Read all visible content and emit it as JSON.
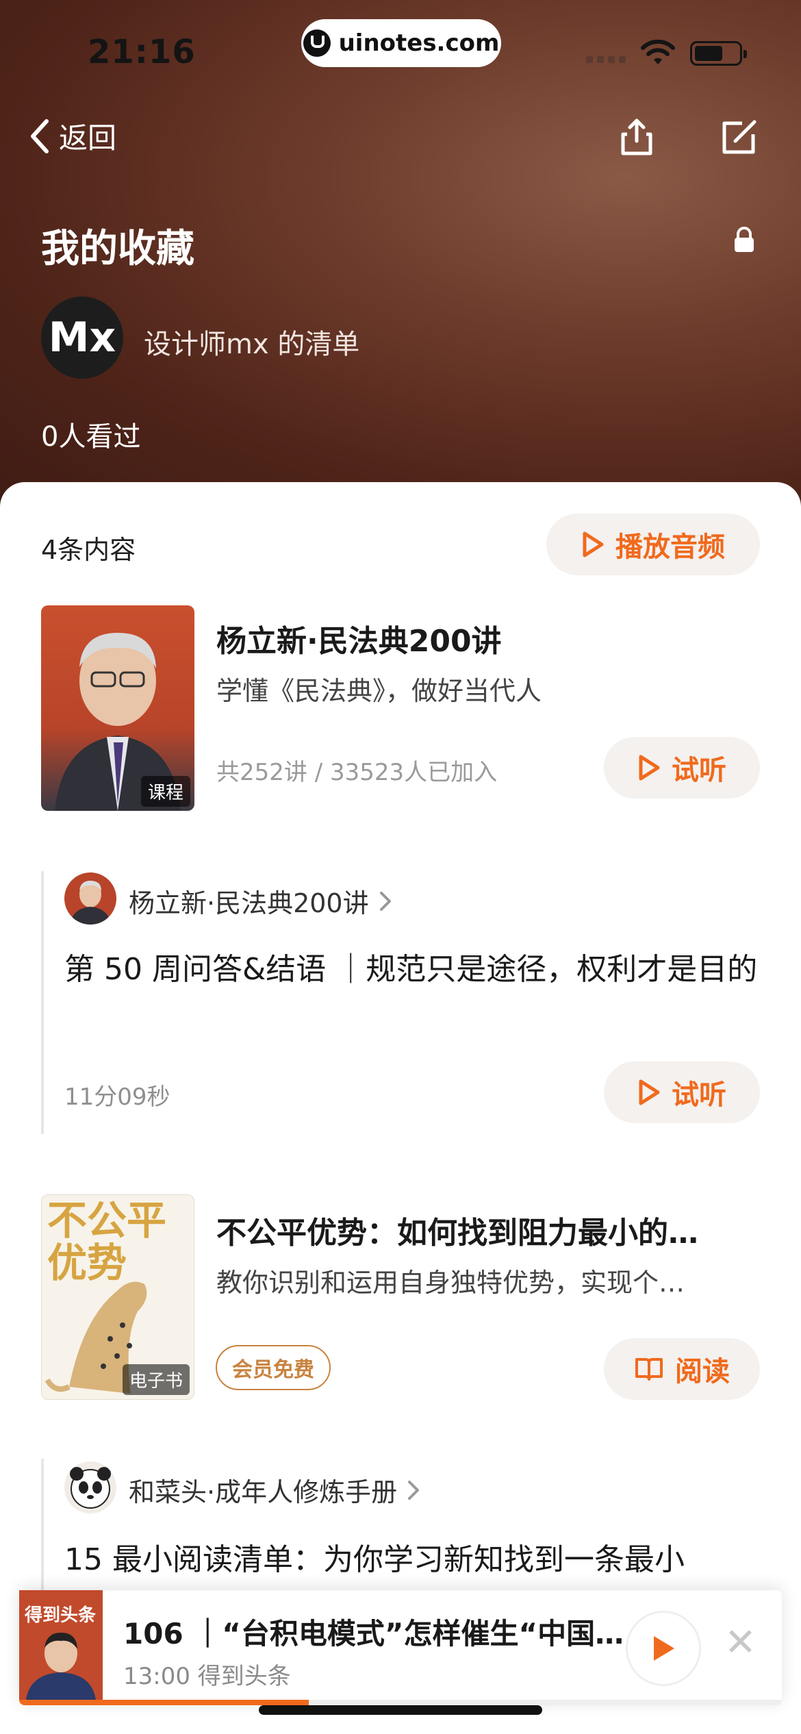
{
  "status_bar": {
    "time": "21:16",
    "url": "uinotes.com"
  },
  "nav": {
    "back_label": "返回"
  },
  "header": {
    "title": "我的收藏",
    "owner": "设计师mx 的清单",
    "views": "0人看过",
    "avatar_text": "Mx"
  },
  "list": {
    "count": "4条内容",
    "play_audio_label": "播放音频",
    "items": [
      {
        "cover_tag": "课程",
        "title": "杨立新·民法典200讲",
        "subtitle": "学懂《民法典》，做好当代人",
        "meta": "共252讲 / 33523人已加入",
        "action": "试听"
      },
      {
        "source": "杨立新·民法典200讲",
        "title": "第 50 周问答&结语 ｜规范只是途径，权利才是目的",
        "meta": "11分09秒",
        "action": "试听"
      },
      {
        "cover_tag": "电子书",
        "cover_text": "不公平优势",
        "title": "不公平优势：如何找到阻力最小的…",
        "subtitle": "教你识别和运用自身独特优势，实现个…",
        "badge": "会员免费",
        "action": "阅读"
      },
      {
        "source": "和菜头·成年人修炼手册",
        "title": "15 最小阅读清单：为你学习新知找到一条最小"
      }
    ]
  },
  "mini_player": {
    "cover_text": "得到头条",
    "title": "106 ｜“台积电模式”怎样催生“中国…",
    "subtitle": "13:00 得到头条",
    "progress": 0.38
  },
  "colors": {
    "accent": "#f06a1d",
    "hero": "#5a2a1e",
    "badge": "#c8833f"
  }
}
